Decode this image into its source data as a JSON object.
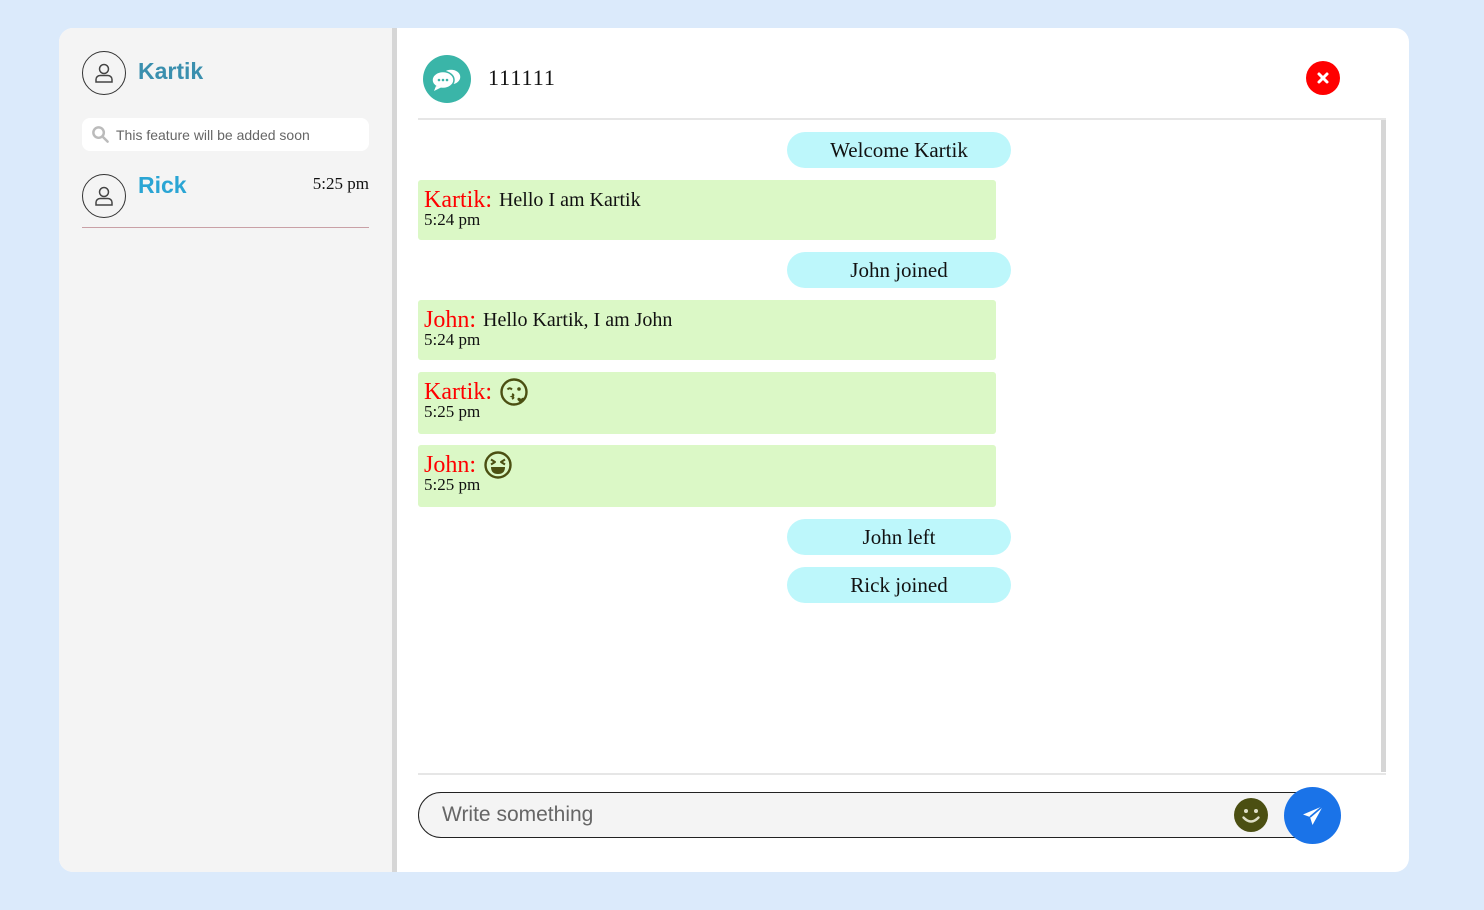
{
  "user": {
    "name": "Kartik",
    "avatar_icon": "user-icon"
  },
  "search": {
    "placeholder": "This feature will be added soon",
    "icon": "search-icon"
  },
  "contacts": [
    {
      "name": "Rick",
      "time": "5:25 pm",
      "avatar_icon": "user-icon"
    }
  ],
  "chat": {
    "room_name": "111111",
    "room_icon": "chat-bubbles-icon",
    "close_icon": "close-icon",
    "messages": [
      {
        "kind": "notice",
        "text": "Welcome Kartik"
      },
      {
        "kind": "message",
        "sender": "Kartik:",
        "text": "Hello I am Kartik",
        "time": "5:24 pm"
      },
      {
        "kind": "notice",
        "text": "John joined"
      },
      {
        "kind": "message",
        "sender": "John:",
        "text": "Hello Kartik, I am John",
        "time": "5:24 pm"
      },
      {
        "kind": "message",
        "sender": "Kartik:",
        "emoji": "kissing-wink-heart-emoji",
        "time": "5:25 pm"
      },
      {
        "kind": "message",
        "sender": "John:",
        "emoji": "laughing-squint-emoji",
        "time": "5:25 pm"
      },
      {
        "kind": "notice",
        "text": "John left"
      },
      {
        "kind": "notice",
        "text": "Rick joined"
      }
    ]
  },
  "composer": {
    "placeholder": "Write something",
    "emoji_icon": "smiley-icon",
    "send_icon": "send-icon"
  },
  "colors": {
    "page_bg": "#dbeafb",
    "sidebar_bg": "#f4f4f4",
    "user_name": "#3a8fae",
    "contact_name": "#2aa5d4",
    "notice_bg": "#bdf7fb",
    "message_bg": "#dbf8c6",
    "sender": "#ff0000",
    "close_button": "#ff0000",
    "send_button": "#1a73e8",
    "room_icon_bg": "#3ab5a8",
    "emoji": "#4b4f12"
  }
}
